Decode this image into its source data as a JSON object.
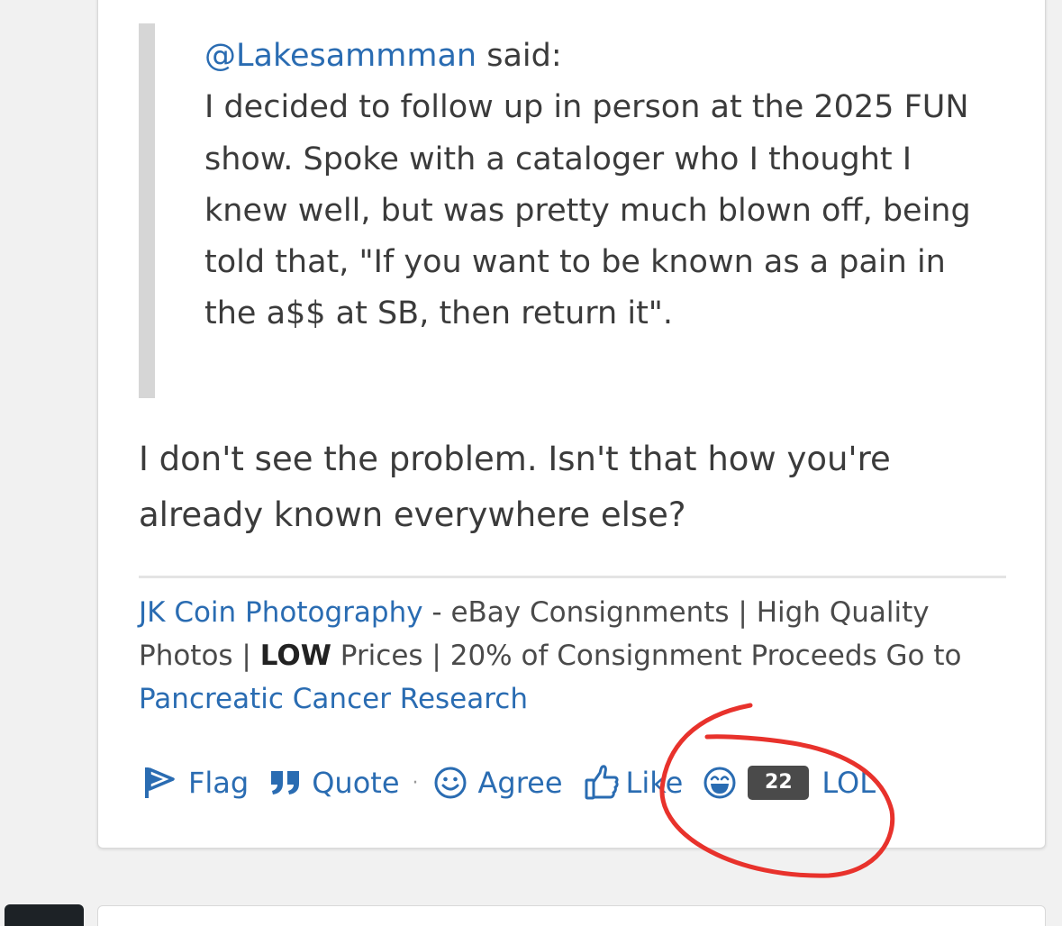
{
  "quote": {
    "author": "@Lakesammman",
    "said_label": "said:",
    "body": "I decided to follow up in person at the 2025 FUN show. Spoke with a cataloger who I thought I knew well, but was pretty much blown off, being told that, \"If you want to be known as a pain in the a$$ at SB, then return it\"."
  },
  "reply": {
    "text": "I don't see the problem. Isn't that how you're already known everywhere else?"
  },
  "signature": {
    "link1": "JK Coin Photography",
    "part1": " - eBay Consignments | High Quality Photos | ",
    "bold": "LOW",
    "part2": " Prices | 20% of Consignment Proceeds Go to ",
    "link2": "Pancreatic Cancer Research"
  },
  "actions": {
    "flag_label": "Flag",
    "quote_label": "Quote",
    "separator": "·",
    "agree_label": "Agree",
    "like_label": "Like",
    "lol_count": "22",
    "lol_label": "LOL"
  },
  "colors": {
    "link": "#2a6cb2",
    "text": "#3b3b3b",
    "badge": "#4a4a4a",
    "annotation": "#e8322c"
  },
  "icons": [
    "flag-icon",
    "quote-icon",
    "agree-smile-icon",
    "thumbs-up-icon",
    "laughing-face-icon"
  ]
}
